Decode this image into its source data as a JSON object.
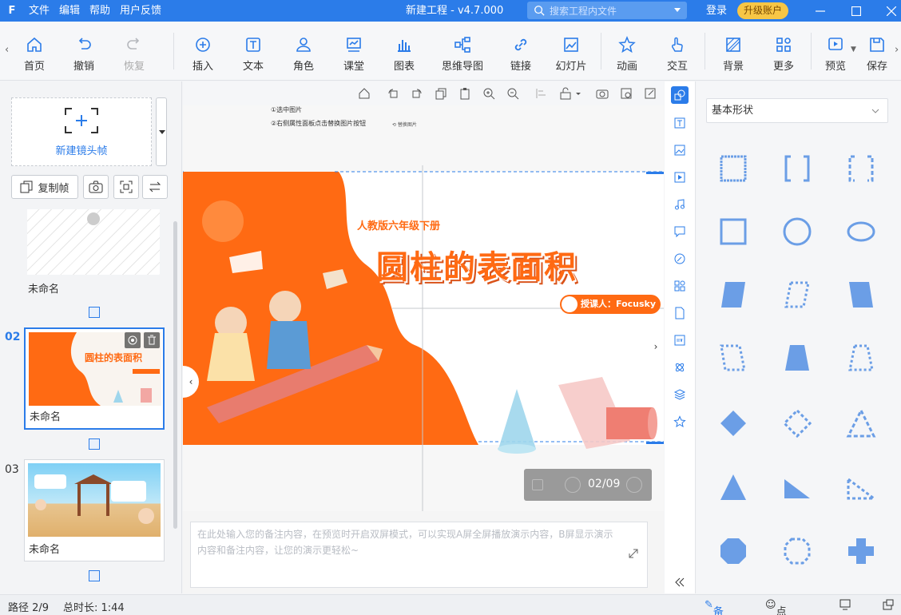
{
  "titlebar": {
    "logo": "F",
    "menu": [
      "文件",
      "编辑",
      "帮助",
      "用户反馈"
    ],
    "title": "新建工程 - v4.7.000",
    "search_placeholder": "搜索工程内文件",
    "login": "登录",
    "upgrade": "升级账户"
  },
  "toolbar": {
    "items": [
      {
        "label": "首页",
        "icon": "home-icon"
      },
      {
        "label": "撤销",
        "icon": "undo-icon"
      },
      {
        "label": "恢复",
        "icon": "redo-icon"
      },
      {
        "label": "插入",
        "icon": "plus-circle-icon"
      },
      {
        "label": "文本",
        "icon": "text-icon"
      },
      {
        "label": "角色",
        "icon": "person-icon"
      },
      {
        "label": "课堂",
        "icon": "classroom-icon"
      },
      {
        "label": "图表",
        "icon": "bar-chart-icon"
      },
      {
        "label": "思维导图",
        "icon": "mindmap-icon"
      },
      {
        "label": "链接",
        "icon": "link-icon"
      },
      {
        "label": "幻灯片",
        "icon": "slide-icon"
      },
      {
        "label": "动画",
        "icon": "star-icon"
      },
      {
        "label": "交互",
        "icon": "hand-icon"
      },
      {
        "label": "背景",
        "icon": "background-icon"
      },
      {
        "label": "更多",
        "icon": "more-icon"
      },
      {
        "label": "预览",
        "icon": "play-icon"
      },
      {
        "label": "保存",
        "icon": "save-icon"
      }
    ]
  },
  "leftpanel": {
    "new_frame": "新建镜头帧",
    "copy_frame": "复制帧",
    "frames": [
      {
        "num": "",
        "name": "未命名"
      },
      {
        "num": "02",
        "name": "未命名"
      },
      {
        "num": "03",
        "name": "未命名"
      }
    ]
  },
  "canvas": {
    "hint1": "①选中图片",
    "hint2": "②右侧属性面板点击替换图片按钮",
    "hint3": "⟲ 替换图片",
    "slide_subtitle": "人教版六年级下册",
    "slide_title": "圆柱的表面积",
    "slide_teacher": "授课人：Focusky",
    "page_indicator": "02/09"
  },
  "notes": {
    "placeholder": "在此处输入您的备注内容，在预览时开启双屏模式，可以实现A屏全屏播放演示内容，B屏显示演示内容和备注内容，让您的演示更轻松~"
  },
  "shapepanel": {
    "category": "基本形状",
    "accent": "#6b9ee6"
  },
  "statusbar": {
    "path": "路径 2/9",
    "duration": "总时长: 1:44",
    "notes": "备注",
    "rollcall": "点名"
  },
  "colors": {
    "primary": "#2b7ce9",
    "slide_orange": "#ff6a13"
  }
}
